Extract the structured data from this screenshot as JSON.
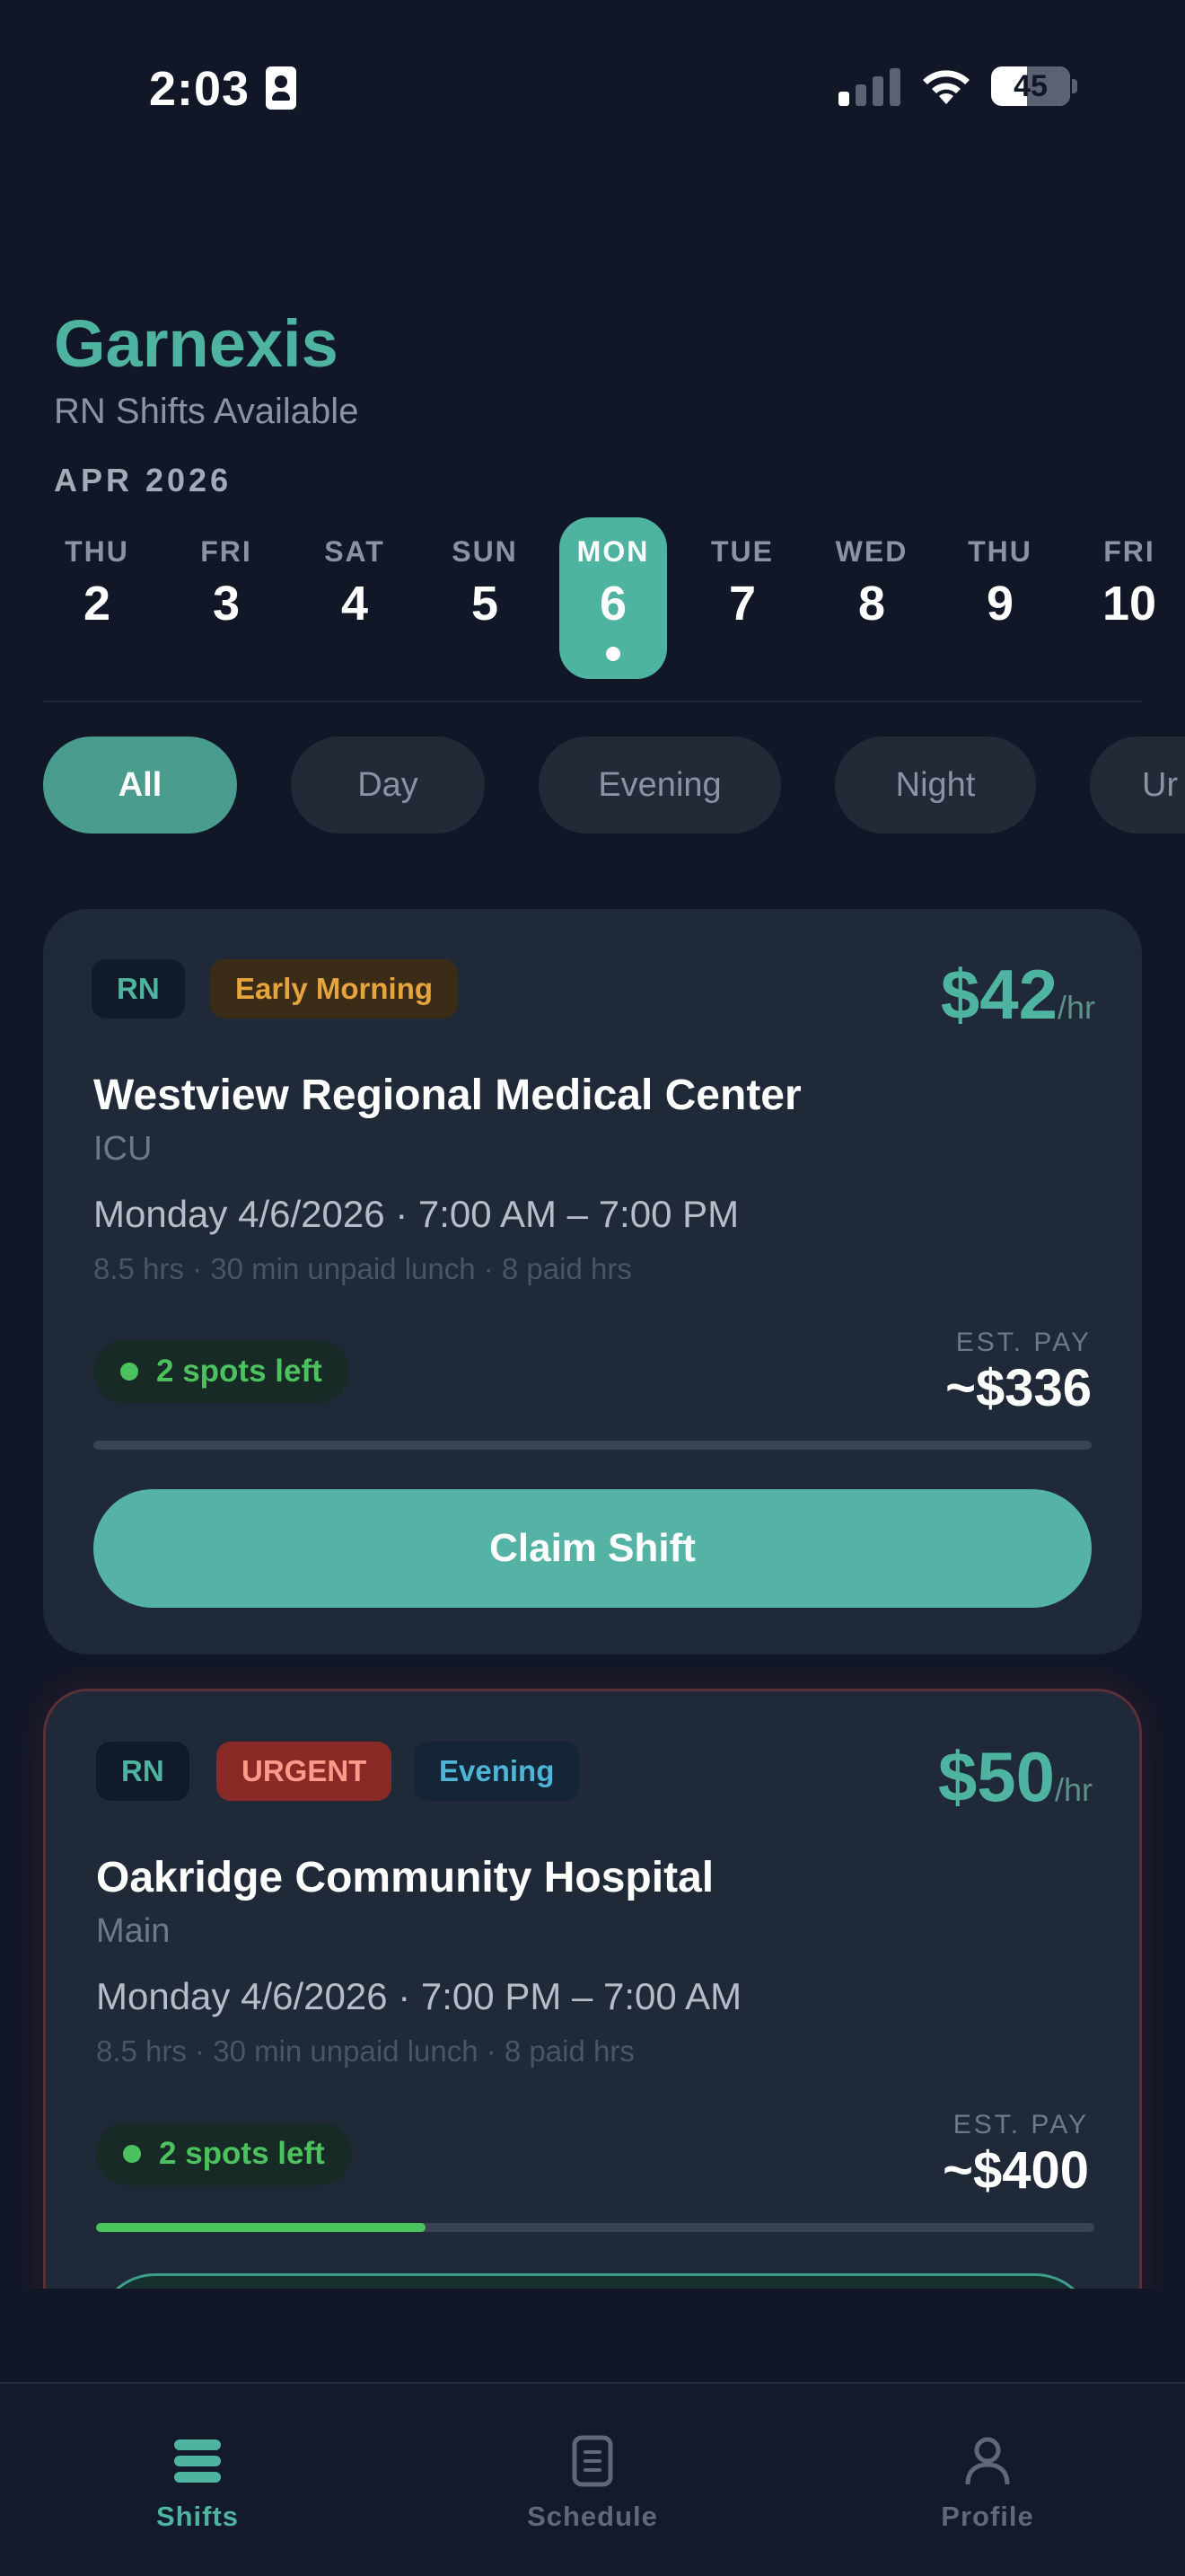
{
  "status_bar": {
    "time": "2:03",
    "battery": "45"
  },
  "header": {
    "app_title": "Garnexis",
    "subtitle": "RN Shifts Available",
    "month": "APR 2026"
  },
  "date_strip": [
    {
      "dow": "THU",
      "day": "2"
    },
    {
      "dow": "FRI",
      "day": "3"
    },
    {
      "dow": "SAT",
      "day": "4"
    },
    {
      "dow": "SUN",
      "day": "5"
    },
    {
      "dow": "MON",
      "day": "6",
      "selected": true
    },
    {
      "dow": "TUE",
      "day": "7"
    },
    {
      "dow": "WED",
      "day": "8"
    },
    {
      "dow": "THU",
      "day": "9"
    },
    {
      "dow": "FRI",
      "day": "10"
    }
  ],
  "filters": [
    "All",
    "Day",
    "Evening",
    "Night",
    "Ur"
  ],
  "selected_filter": "All",
  "shifts": [
    {
      "tags": [
        "RN",
        "Early Morning"
      ],
      "rate": "$42",
      "rate_unit": "/hr",
      "facility": "Westview Regional Medical Center",
      "unit": "ICU",
      "datetime": "Monday 4/6/2026  ·  7:00 AM – 7:00 PM",
      "details": "8.5 hrs · 30 min unpaid lunch · 8 paid hrs",
      "spots": "2 spots left",
      "est_label": "EST. PAY",
      "est_value": "~$336",
      "fill_fraction": 0.0,
      "button": "Claim Shift"
    },
    {
      "tags": [
        "RN",
        "URGENT",
        "Evening"
      ],
      "rate": "$50",
      "rate_unit": "/hr",
      "facility": "Oakridge Community Hospital",
      "unit": "Main",
      "datetime": "Monday 4/6/2026  ·  7:00 PM – 7:00 AM",
      "details": "8.5 hrs · 30 min unpaid lunch · 8 paid hrs",
      "spots": "2 spots left",
      "est_label": "EST. PAY",
      "est_value": "~$400",
      "fill_fraction": 0.33
    }
  ],
  "nav": [
    {
      "label": "Shifts",
      "icon": "menu-icon",
      "active": true
    },
    {
      "label": "Schedule",
      "icon": "clipboard-icon"
    },
    {
      "label": "Profile",
      "icon": "person-icon"
    }
  ],
  "colors": {
    "accent": "#4fb3a1",
    "background": "#111727",
    "card": "#1f2938",
    "urgent": "#8a2a26",
    "available": "#4cc25e"
  }
}
